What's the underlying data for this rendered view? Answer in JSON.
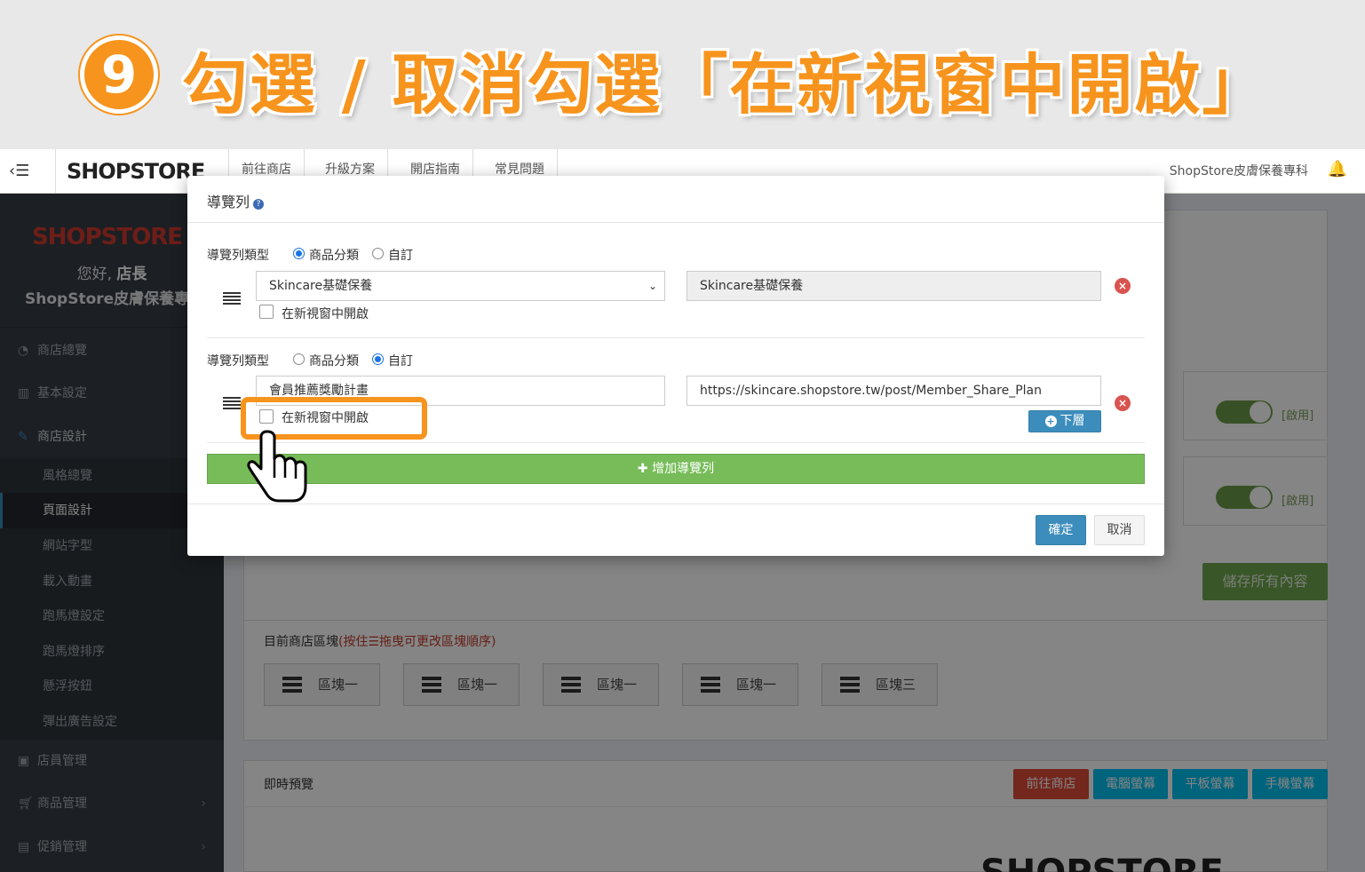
{
  "banner": {
    "step_number": "9",
    "title": "勾選 / 取消勾選「在新視窗中開啟」"
  },
  "topnav": {
    "brand": "SHOPSTORE",
    "items": [
      "前往商店",
      "升級方案",
      "開店指南",
      "常見問題"
    ],
    "store_name": "ShopStore皮膚保養專科"
  },
  "sidebar": {
    "logo": "SHOPSTORE",
    "greeting_prefix": "您好,",
    "greeting_user": "店長",
    "store_name": "ShopStore皮膚保養專科",
    "items": [
      {
        "label": "商店總覽"
      },
      {
        "label": "基本設定"
      },
      {
        "label": "商店設計"
      }
    ],
    "subitems": [
      {
        "label": "風格總覽"
      },
      {
        "label": "頁面設計"
      },
      {
        "label": "網站字型"
      },
      {
        "label": "載入動畫"
      },
      {
        "label": "跑馬燈設定"
      },
      {
        "label": "跑馬燈排序"
      },
      {
        "label": "懸浮按鈕"
      },
      {
        "label": "彈出廣告設定"
      }
    ],
    "bottom_items": [
      {
        "label": "店員管理"
      },
      {
        "label": "商品管理"
      },
      {
        "label": "促銷管理"
      }
    ]
  },
  "content": {
    "toggle_label": "[啟用]",
    "save_all": "儲存所有內容",
    "blocks_label": "目前商店區塊",
    "blocks_hint": "(按住☰拖曳可更改區塊順序)",
    "blocks": [
      "區塊一",
      "區塊一",
      "區塊一",
      "區塊一",
      "區塊三"
    ],
    "preview_label": "即時預覽",
    "preview_buttons": [
      "前往商店",
      "電腦螢幕",
      "平板螢幕",
      "手機螢幕"
    ],
    "preview_logo": "SHOPSTORE"
  },
  "modal": {
    "title": "導覽列",
    "rows": [
      {
        "type_label": "導覽列類型",
        "option_category": "商品分類",
        "option_custom": "自訂",
        "selected": "商品分類",
        "select_value": "Skincare基礎保養",
        "text_value": "Skincare基礎保養",
        "new_window_label": "在新視窗中開啟",
        "new_window_checked": false
      },
      {
        "type_label": "導覽列類型",
        "option_category": "商品分類",
        "option_custom": "自訂",
        "selected": "自訂",
        "name_value": "會員推薦獎勵計畫",
        "url_value": "https://skincare.shopstore.tw/post/Member_Share_Plan",
        "new_window_label": "在新視窗中開啟",
        "new_window_checked": false,
        "sublevel_button": "下層"
      }
    ],
    "add_button": "增加導覽列",
    "confirm": "確定",
    "cancel": "取消"
  },
  "colors": {
    "accent_orange": "#f7941d",
    "primary_blue": "#3c8dbc",
    "success_green": "#77bc59",
    "danger_red": "#d9534f"
  }
}
